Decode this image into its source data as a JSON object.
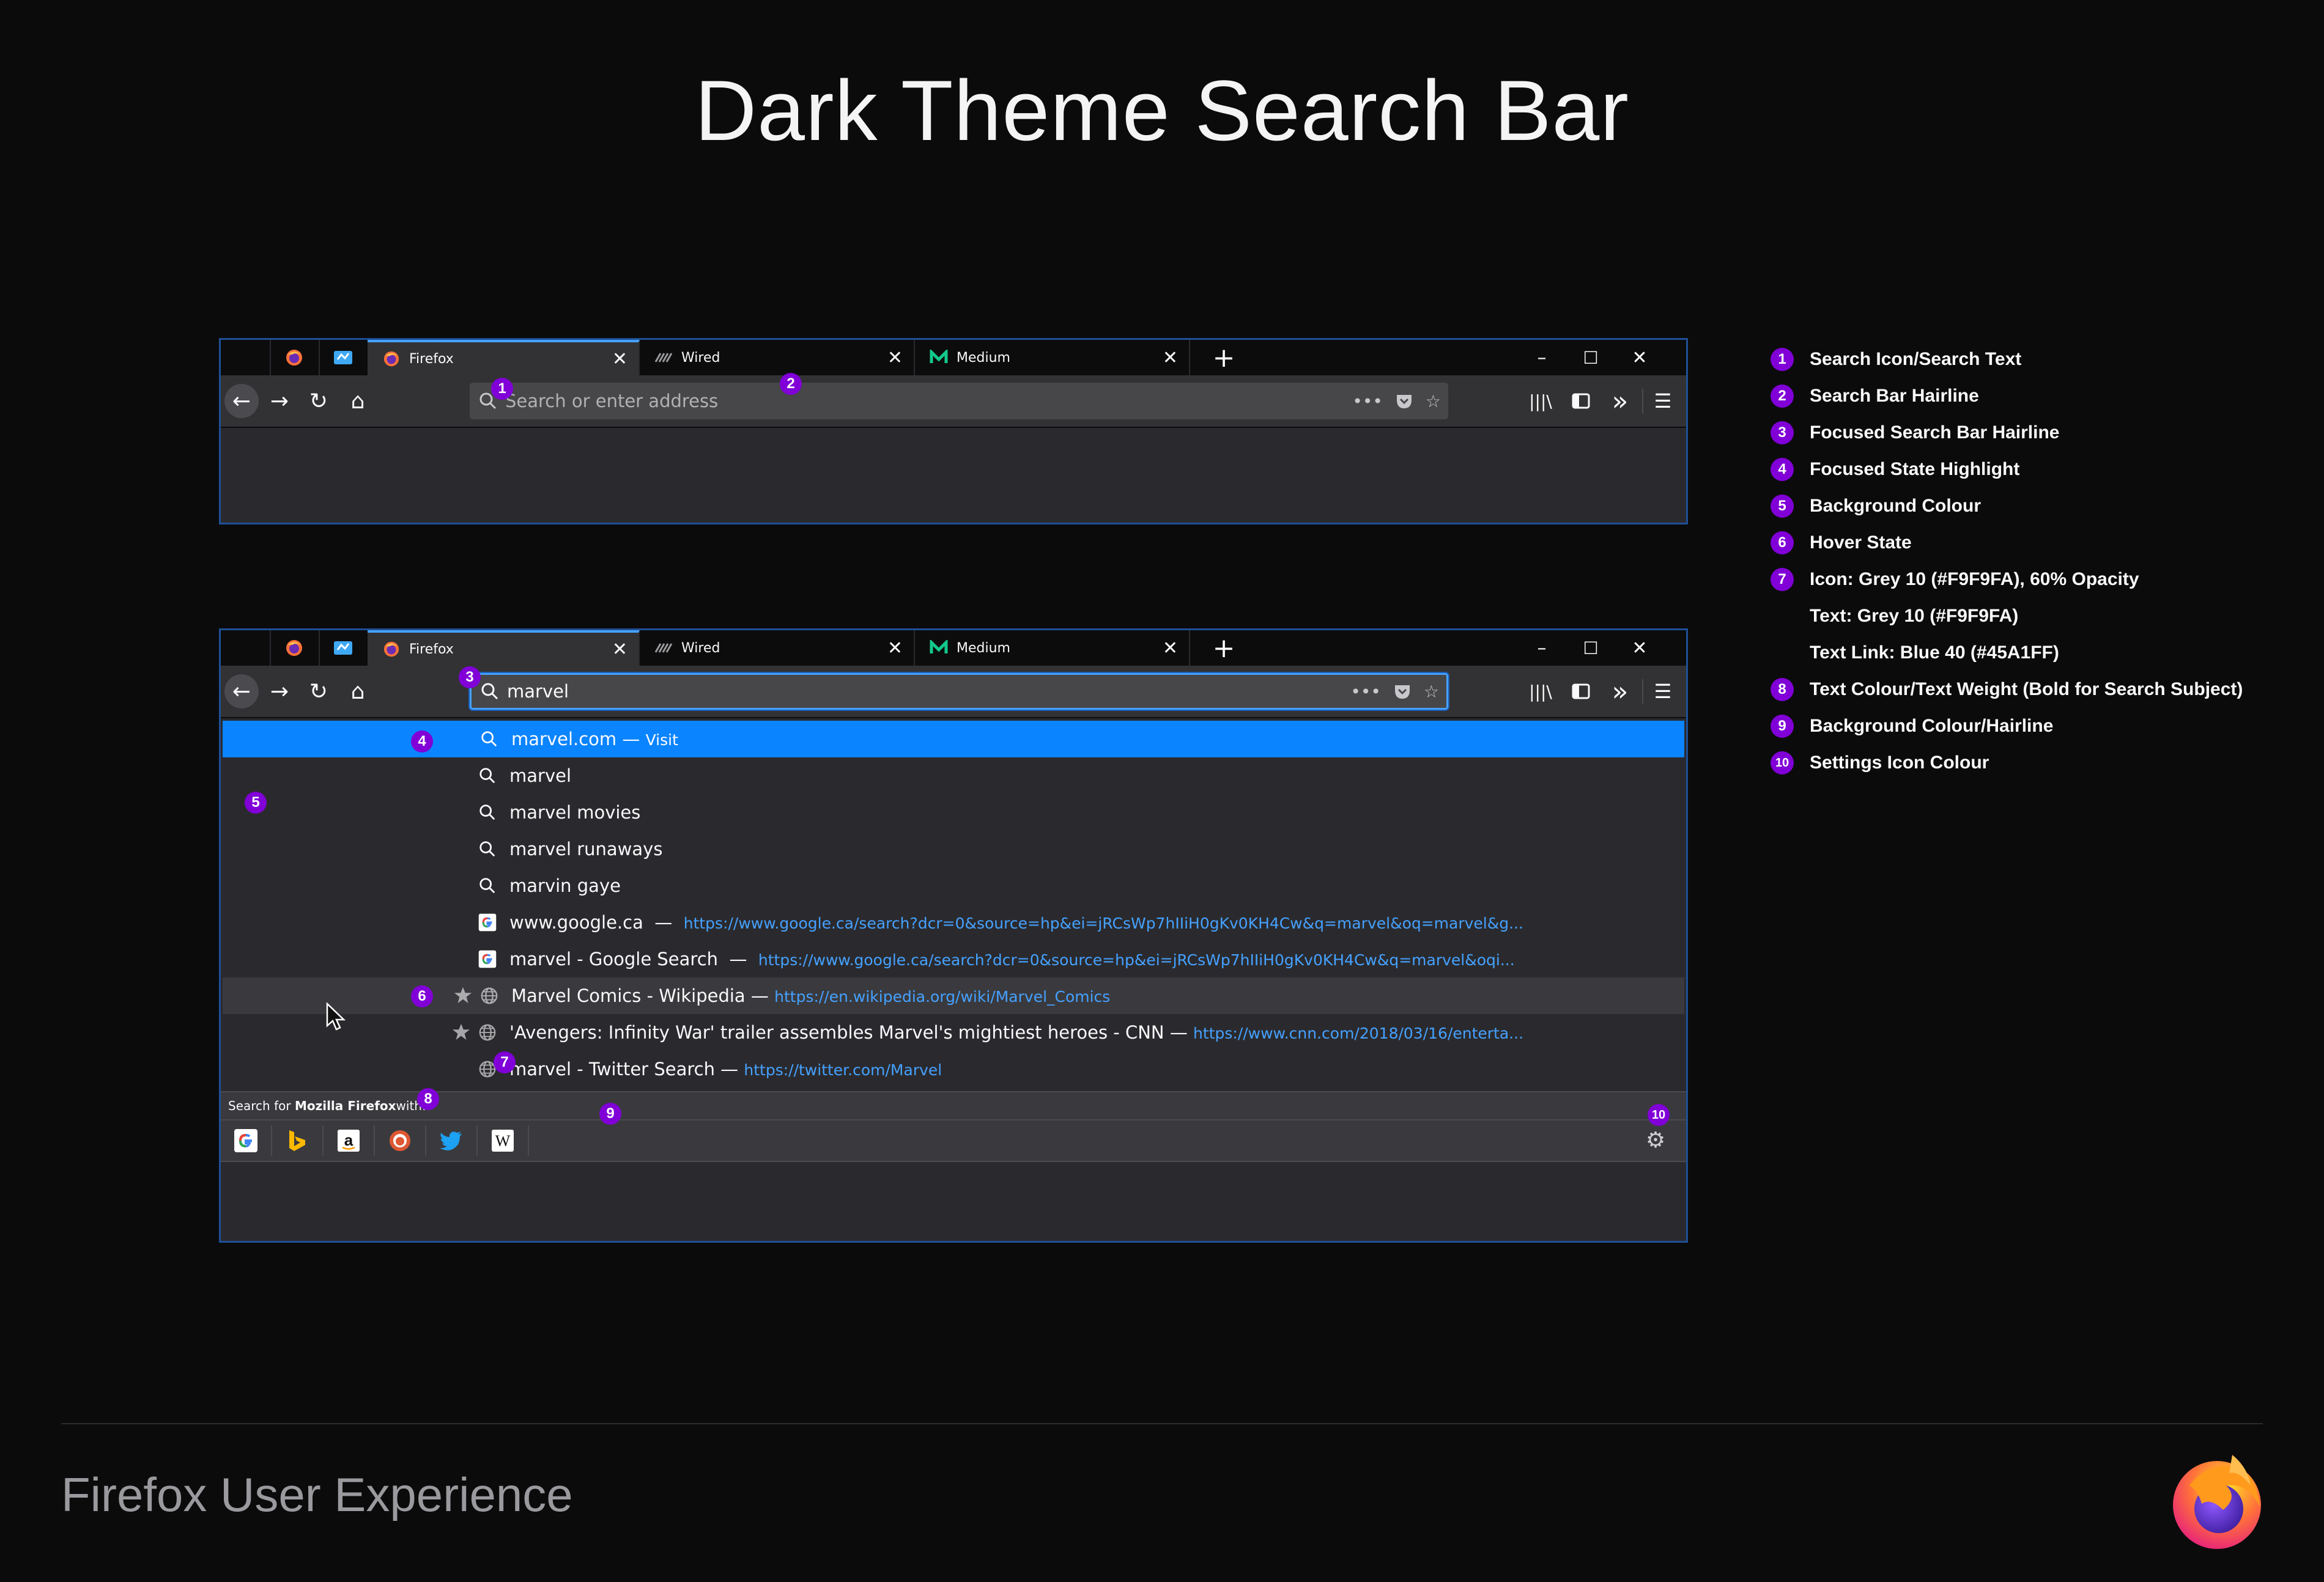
{
  "page": {
    "title": "Dark Theme Search Bar",
    "footer": "Firefox User Experience"
  },
  "colors": {
    "accent": "#45a1ff",
    "highlight": "#0a84ff",
    "callout": "#8000d7",
    "background": "#2a2a2e",
    "tabbar": "#0c0c0d"
  },
  "browser": {
    "tabs": [
      {
        "label": "Firefox",
        "icon": "firefox-icon",
        "close": "✕"
      },
      {
        "label": "Wired",
        "icon": "wired-icon",
        "close": "✕"
      },
      {
        "label": "Medium",
        "icon": "medium-icon",
        "close": "✕"
      }
    ],
    "new_tab": "+",
    "window_controls": {
      "minimize": "–",
      "maximize": "☐",
      "close": "✕"
    },
    "nav": {
      "back": "←",
      "forward": "→",
      "reload": "↻",
      "home": "⌂"
    },
    "url_actions": {
      "more": "•••",
      "pocket": "pocket-icon",
      "star": "☆"
    },
    "tools": {
      "library": "|||\\",
      "sidebar": "sidebar-icon",
      "overflow": "»",
      "menu": "☰"
    }
  },
  "browser1": {
    "urlbar": {
      "placeholder": "Search or enter address"
    }
  },
  "browser2": {
    "urlbar": {
      "value": "marvel"
    },
    "results": [
      {
        "text": "marvel.com",
        "sep": " — ",
        "url": "Visit",
        "icon": "search-icon",
        "state": "highlight",
        "star": false
      },
      {
        "text": "marvel",
        "sep": "",
        "url": "",
        "icon": "search-icon",
        "state": "",
        "star": false
      },
      {
        "text": "marvel movies",
        "sep": "",
        "url": "",
        "icon": "search-icon",
        "state": "",
        "star": false
      },
      {
        "text": "marvel runaways",
        "sep": "",
        "url": "",
        "icon": "search-icon",
        "state": "",
        "star": false
      },
      {
        "text": "marvin gaye",
        "sep": "",
        "url": "",
        "icon": "search-icon",
        "state": "",
        "star": false
      },
      {
        "text": "www.google.ca",
        "sep": "  —  ",
        "url": "https://www.google.ca/search?dcr=0&source=hp&ei=jRCsWp7hIIiH0gKv0KH4Cw&q=marvel&oq=marvel&g...",
        "icon": "google-icon",
        "state": "",
        "star": false
      },
      {
        "text": "marvel - Google Search",
        "sep": "  —  ",
        "url": "https://www.google.ca/search?dcr=0&source=hp&ei=jRCsWp7hIIiH0gKv0KH4Cw&q=marvel&oqi...",
        "icon": "google-icon",
        "state": "",
        "star": false
      },
      {
        "text": "Marvel Comics - Wikipedia",
        "sep": " — ",
        "url": "https://en.wikipedia.org/wiki/Marvel_Comics",
        "icon": "globe-icon",
        "state": "hover",
        "star": true
      },
      {
        "text": "'Avengers: Infinity War' trailer assembles Marvel's mightiest heroes - CNN",
        "sep": " — ",
        "url": "https://www.cnn.com/2018/03/16/enterta...",
        "icon": "globe-icon",
        "state": "",
        "star": true
      },
      {
        "text": "marvel - Twitter Search",
        "sep": " — ",
        "url": "https://twitter.com/Marvel",
        "icon": "globe-icon",
        "state": "",
        "star": false
      }
    ],
    "oneoff": {
      "prefix": "Search for ",
      "subject": "Mozilla Firefox",
      "suffix": " with:",
      "engines": [
        "google-icon",
        "bing-icon",
        "amazon-icon",
        "duckduckgo-icon",
        "twitter-icon",
        "wikipedia-icon"
      ],
      "settings": "⚙"
    }
  },
  "callouts": [
    "1",
    "2",
    "3",
    "4",
    "5",
    "6",
    "7",
    "8",
    "9",
    "10"
  ],
  "legend": [
    {
      "num": "1",
      "text": "Search Icon/Search Text"
    },
    {
      "num": "2",
      "text": "Search Bar Hairline"
    },
    {
      "num": "3",
      "text": "Focused Search Bar Hairline"
    },
    {
      "num": "4",
      "text": "Focused State Highlight"
    },
    {
      "num": "5",
      "text": "Background Colour"
    },
    {
      "num": "6",
      "text": "Hover State"
    },
    {
      "num": "7",
      "text": "Icon: Grey 10 (#F9F9FA), 60% Opacity"
    },
    {
      "num": "",
      "text": "Text: Grey 10 (#F9F9FA)"
    },
    {
      "num": "",
      "text": "Text Link: Blue 40 (#45A1FF)"
    },
    {
      "num": "8",
      "text": "Text Colour/Text Weight (Bold for Search Subject)"
    },
    {
      "num": "9",
      "text": "Background Colour/Hairline"
    },
    {
      "num": "10",
      "text": "Settings Icon Colour"
    }
  ]
}
